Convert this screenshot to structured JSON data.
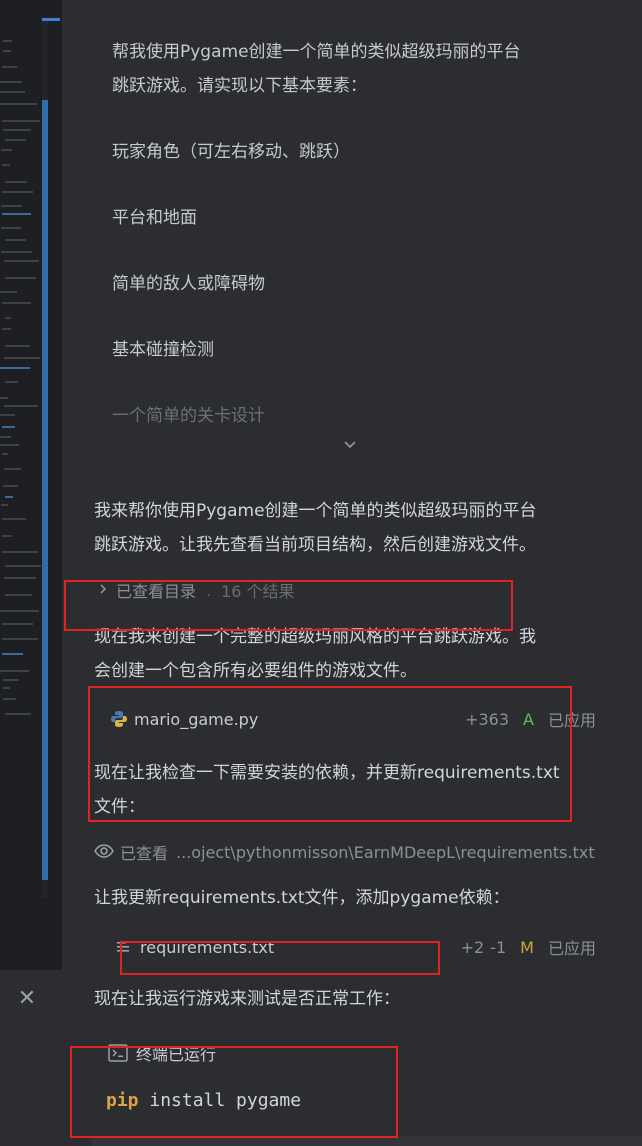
{
  "user_message": {
    "lines": [
      "帮我使用Pygame创建一个简单的类似超级玛丽的平台",
      "跳跃游戏。请实现以下基本要素："
    ],
    "items": [
      "玩家角色（可左右移动、跳跃）",
      "平台和地面",
      "简单的敌人或障碍物",
      "基本碰撞检测",
      "一个简单的关卡设计"
    ]
  },
  "assistant": {
    "intro": [
      "我来帮你使用Pygame创建一个简单的类似超级玛丽的平台",
      "跳跃游戏。让我先查看当前项目结构，然后创建游戏文件。"
    ],
    "viewed_dir": {
      "label": "已查看目录",
      "sep": ".",
      "count": "16 个结果"
    },
    "create_msg": [
      "现在我来创建一个完整的超级玛丽风格的平台跳跃游戏。我",
      "会创建一个包含所有必要组件的游戏文件。"
    ],
    "file1": {
      "name": "mario_game.py",
      "diff": "+363",
      "status": "A",
      "applied": "已应用"
    },
    "check_msg": [
      "现在让我检查一下需要安装的依赖，并更新requirements.txt",
      "文件："
    ],
    "viewed_file": {
      "label": "已查看",
      "path": "...oject\\pythonmisson\\EarnMDeepL\\requirements.txt"
    },
    "update_msg": "让我更新requirements.txt文件，添加pygame依赖：",
    "file2": {
      "name": "requirements.txt",
      "add": "+2",
      "del": "-1",
      "status": "M",
      "applied": "已应用"
    },
    "run_msg": "现在让我运行游戏来测试是否正常工作：",
    "terminal": {
      "label": "终端已运行",
      "cmd_keyword": "pip",
      "cmd_rest": " install pygame"
    }
  },
  "icons": [
    "chevron-down-icon",
    "chevron-right-icon",
    "python-file-icon",
    "eye-icon",
    "text-file-icon",
    "terminal-icon",
    "close-icon"
  ],
  "colors": {
    "panel_bg": "#2b2d30",
    "added": "#5fb85f",
    "modified": "#d2a53c",
    "annotation": "#e02424"
  }
}
